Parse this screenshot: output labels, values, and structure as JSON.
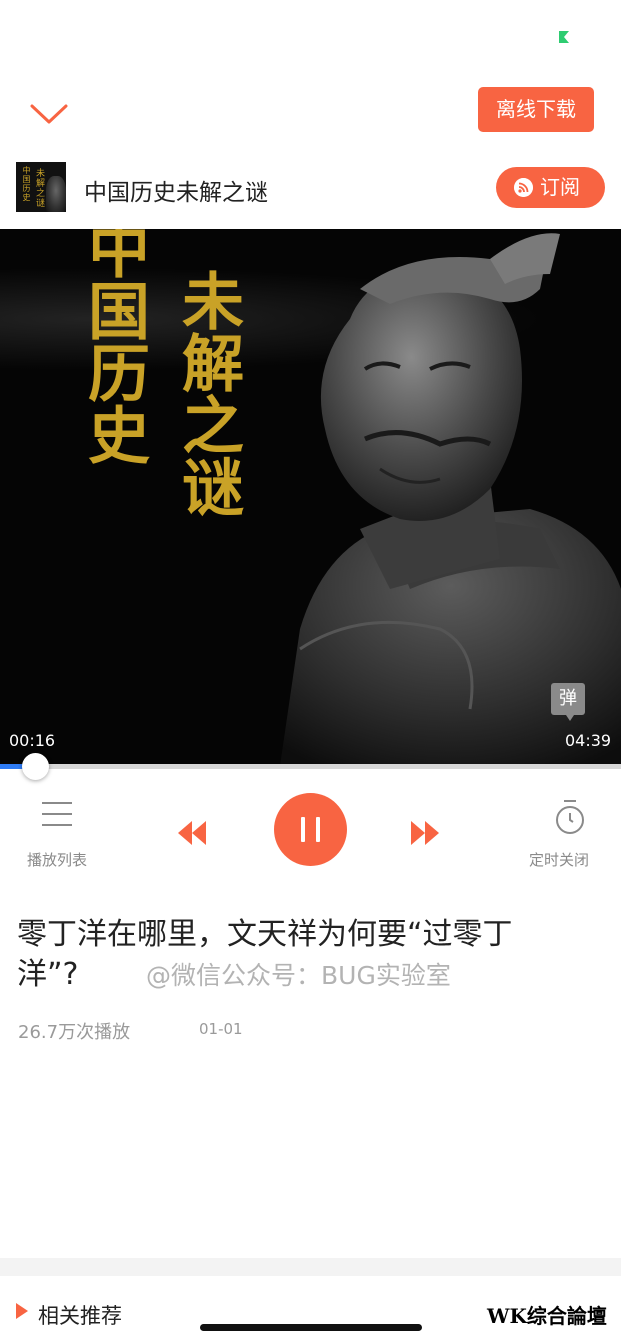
{
  "header": {
    "offline_download_label": "离线下载"
  },
  "album": {
    "title": "中国历史未解之谜",
    "cover_line_1": "中国历史",
    "cover_line_2": "未解之谜",
    "subscribe_label": "订阅"
  },
  "cover": {
    "text_line_1": "中国历史",
    "text_line_2": "未解之谜",
    "danmaku_label": "弹"
  },
  "player": {
    "time_current": "00:16",
    "time_total": "04:39",
    "progress_fraction": 0.057,
    "playlist_label": "播放列表",
    "timer_label": "定时关闭"
  },
  "episode": {
    "title": "零丁洋在哪里，文天祥为何要“过零丁洋”?",
    "watermark": "@微信公众号：BUG实验室",
    "play_count": "26.7万次播放",
    "date": "01-01"
  },
  "related": {
    "label": "相关推荐"
  },
  "forum_watermark": "WK综合論壇",
  "colors": {
    "accent": "#f86442",
    "progress": "#2e7cf6",
    "cover_text": "#c9a227",
    "status_indicator": "#2ecc71"
  }
}
